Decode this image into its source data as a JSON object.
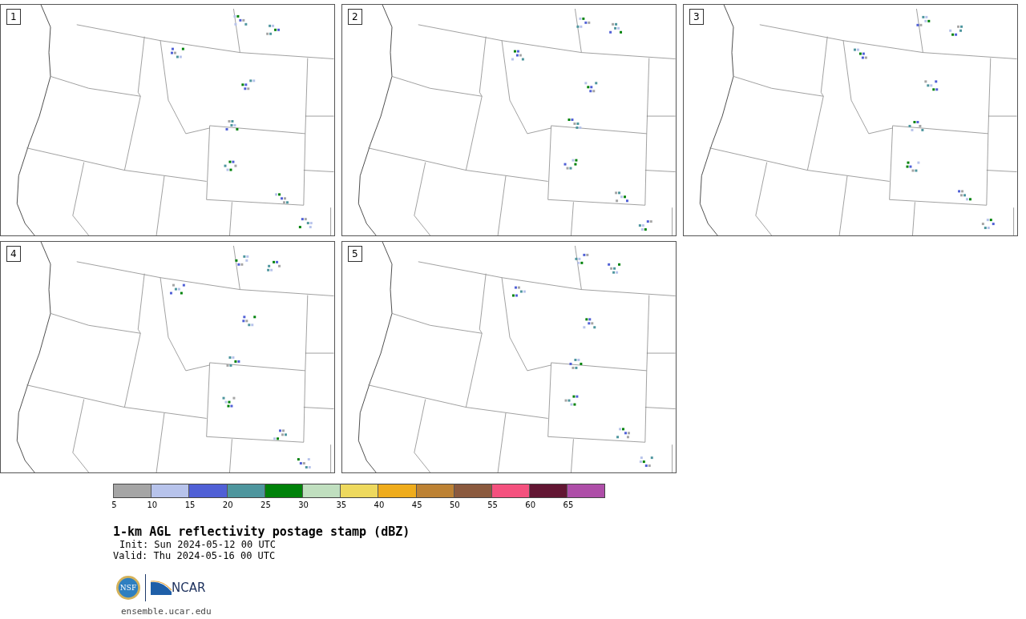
{
  "panels": [
    {
      "label": "1"
    },
    {
      "label": "2"
    },
    {
      "label": "3"
    },
    {
      "label": "4"
    },
    {
      "label": "5"
    }
  ],
  "colorbar": {
    "segments": [
      {
        "tick": "5",
        "color": "#a5a5a5"
      },
      {
        "tick": "10",
        "color": "#b7c3eb"
      },
      {
        "tick": "15",
        "color": "#5060d6"
      },
      {
        "tick": "20",
        "color": "#4e969e"
      },
      {
        "tick": "25",
        "color": "#00820a"
      },
      {
        "tick": "30",
        "color": "#c0dfbf"
      },
      {
        "tick": "35",
        "color": "#eed95e"
      },
      {
        "tick": "40",
        "color": "#efac1c"
      },
      {
        "tick": "45",
        "color": "#bd8234"
      },
      {
        "tick": "50",
        "color": "#8b5a3e"
      },
      {
        "tick": "55",
        "color": "#f4517e"
      },
      {
        "tick": "60",
        "color": "#621633"
      },
      {
        "tick": "65",
        "color": "#ae4ea8"
      }
    ]
  },
  "title": "1-km AGL reflectivity postage stamp (dBZ)",
  "init": "Init: Sun 2024-05-12 00 UTC",
  "valid": "Valid: Thu 2024-05-16 00 UTC",
  "logos": {
    "nsf": "NSF",
    "ncar": "NCAR"
  },
  "footer": "ensemble.ucar.edu"
}
